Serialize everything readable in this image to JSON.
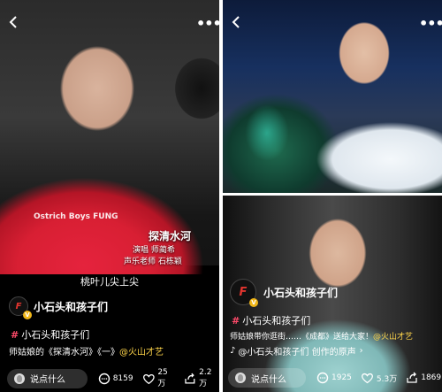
{
  "left": {
    "song_card": {
      "title": "探清水河",
      "line1": "演唱  师蔺希",
      "line2": "声乐老师  石栋颖"
    },
    "shirt_text": "Ostrich Boys FUNG",
    "lyric": "桃叶儿尖上尖",
    "account_name": "小石头和孩子们",
    "tag": "小石头和孩子们",
    "description_prefix": "师姑娘的《探清水河》《一》",
    "description_topic": "@火山才艺",
    "comment_placeholder": "说点什么",
    "comment_count": "8159",
    "like_count": "25万",
    "share_count": "2.2万"
  },
  "right_bottom": {
    "account_name": "小石头和孩子们",
    "tag": "小石头和孩子们",
    "description_prefix": "师姑娘带你逛街……《成都》送给大家！",
    "description_topic": "@火山才艺",
    "music": "@小石头和孩子们 创作的原声",
    "comment_placeholder": "说点什么",
    "comment_count": "1925",
    "like_count": "5.3万",
    "share_count": "1869"
  },
  "icons": {
    "back": "chevron-left-icon",
    "more": "more-dots-icon",
    "comment": "comment-bubble-icon",
    "like": "heart-icon",
    "share": "share-icon"
  },
  "colors": {
    "tag_hash": "#ff4a6a",
    "topic": "#ffd54a",
    "verified": "#f0b619",
    "logo": "#e3352f"
  }
}
